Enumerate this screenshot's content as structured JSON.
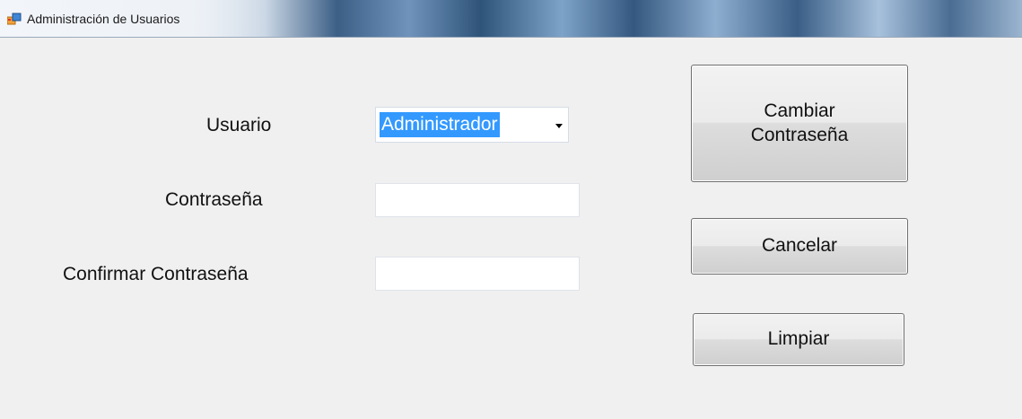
{
  "window": {
    "title": "Administración de Usuarios",
    "icon": "windows-form-icon"
  },
  "form": {
    "usuario_label": "Usuario",
    "usuario_selected": "Administrador",
    "contrasena_label": "Contraseña",
    "contrasena_value": "",
    "confirmar_label": "Confirmar Contraseña",
    "confirmar_value": ""
  },
  "buttons": {
    "cambiar_line1": "Cambiar",
    "cambiar_line2": "Contraseña",
    "cancelar": "Cancelar",
    "limpiar": "Limpiar"
  },
  "colors": {
    "selection": "#3399ff",
    "window_bg": "#f0f0f0"
  }
}
